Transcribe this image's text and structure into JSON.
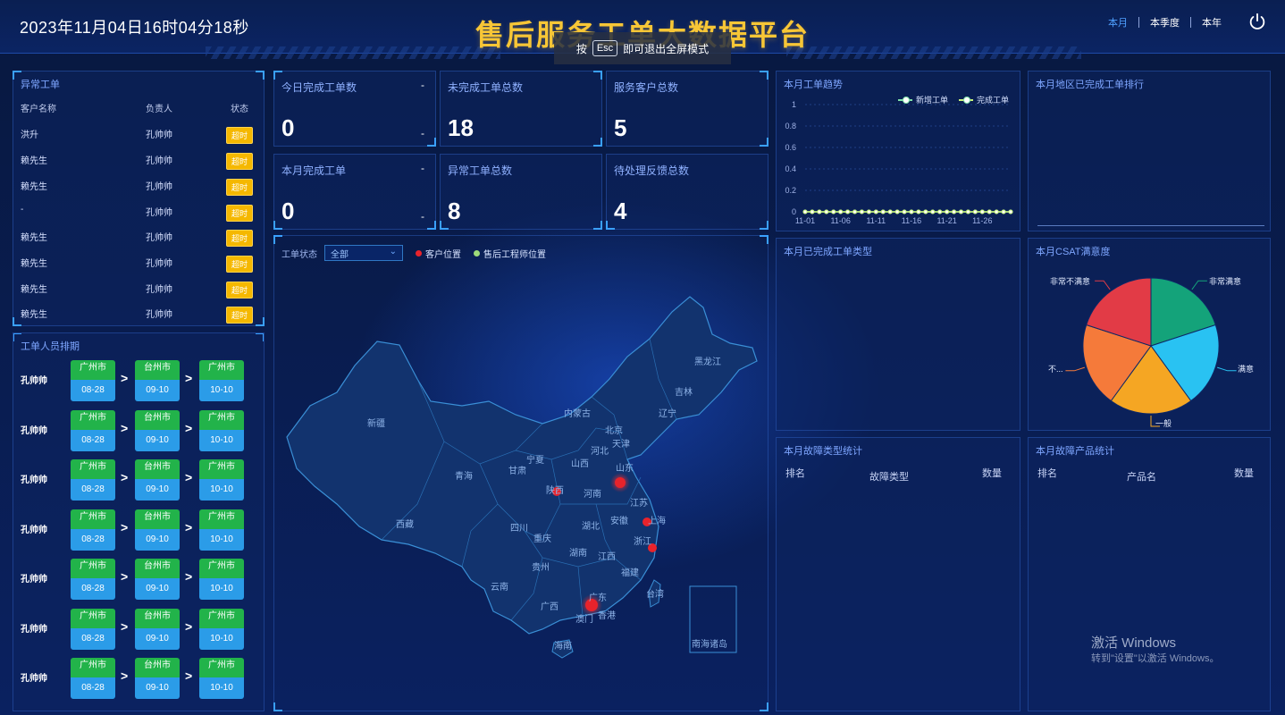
{
  "header": {
    "clock": "2023年11月04日16时04分18秒",
    "title": "售后服务工单大数据平台",
    "fullscreen_tip": {
      "prefix": "按",
      "key": "Esc",
      "suffix": "即可退出全屏模式"
    },
    "range_tabs": [
      "本月",
      "本季度",
      "本年"
    ],
    "active_range": "本月",
    "power_icon": "power-icon"
  },
  "abnormal": {
    "title": "异常工单",
    "columns": [
      "客户名称",
      "负责人",
      "状态"
    ],
    "rows": [
      {
        "customer": "洪升",
        "owner": "孔帅帅",
        "status": "超时"
      },
      {
        "customer": "赖先生",
        "owner": "孔帅帅",
        "status": "超时"
      },
      {
        "customer": "赖先生",
        "owner": "孔帅帅",
        "status": "超时"
      },
      {
        "customer": "-",
        "owner": "孔帅帅",
        "status": "超时"
      },
      {
        "customer": "赖先生",
        "owner": "孔帅帅",
        "status": "超时"
      },
      {
        "customer": "赖先生",
        "owner": "孔帅帅",
        "status": "超时"
      },
      {
        "customer": "赖先生",
        "owner": "孔帅帅",
        "status": "超时"
      },
      {
        "customer": "赖先生",
        "owner": "孔帅帅",
        "status": "超时"
      }
    ]
  },
  "schedule": {
    "title": "工单人员排期",
    "rows": [
      {
        "name": "孔帅帅",
        "stops": [
          {
            "city": "广州市",
            "date": "08-28"
          },
          {
            "city": "台州市",
            "date": "09-10"
          },
          {
            "city": "广州市",
            "date": "10-10"
          }
        ]
      },
      {
        "name": "孔帅帅",
        "stops": [
          {
            "city": "广州市",
            "date": "08-28"
          },
          {
            "city": "台州市",
            "date": "09-10"
          },
          {
            "city": "广州市",
            "date": "10-10"
          }
        ]
      },
      {
        "name": "孔帅帅",
        "stops": [
          {
            "city": "广州市",
            "date": "08-28"
          },
          {
            "city": "台州市",
            "date": "09-10"
          },
          {
            "city": "广州市",
            "date": "10-10"
          }
        ]
      },
      {
        "name": "孔帅帅",
        "stops": [
          {
            "city": "广州市",
            "date": "08-28"
          },
          {
            "city": "台州市",
            "date": "09-10"
          },
          {
            "city": "广州市",
            "date": "10-10"
          }
        ]
      },
      {
        "name": "孔帅帅",
        "stops": [
          {
            "city": "广州市",
            "date": "08-28"
          },
          {
            "city": "台州市",
            "date": "09-10"
          },
          {
            "city": "广州市",
            "date": "10-10"
          }
        ]
      },
      {
        "name": "孔帅帅",
        "stops": [
          {
            "city": "广州市",
            "date": "08-28"
          },
          {
            "city": "台州市",
            "date": "09-10"
          },
          {
            "city": "广州市",
            "date": "10-10"
          }
        ]
      },
      {
        "name": "孔帅帅",
        "stops": [
          {
            "city": "广州市",
            "date": "08-28"
          },
          {
            "city": "台州市",
            "date": "09-10"
          },
          {
            "city": "广州市",
            "date": "10-10"
          }
        ]
      }
    ],
    "arrow": ">"
  },
  "stats": [
    {
      "label": "今日完成工单数",
      "value": "0",
      "dash": "-"
    },
    {
      "label": "未完成工单总数",
      "value": "18"
    },
    {
      "label": "服务客户总数",
      "value": "5"
    },
    {
      "label": "本月完成工单",
      "value": "0",
      "dash": "-"
    },
    {
      "label": "异常工单总数",
      "value": "8"
    },
    {
      "label": "待处理反馈总数",
      "value": "4"
    }
  ],
  "map": {
    "filter_label": "工单状态",
    "filter_value": "全部",
    "legend": [
      {
        "label": "客户位置",
        "color": "#e8232b"
      },
      {
        "label": "售后工程师位置",
        "color": "#9ddb7a"
      }
    ],
    "provinces": [
      "黑龙江",
      "吉林",
      "辽宁",
      "内蒙古",
      "北京",
      "天津",
      "河北",
      "山东",
      "山西",
      "宁夏",
      "甘肃",
      "青海",
      "新疆",
      "西藏",
      "四川",
      "重庆",
      "陕西",
      "河南",
      "江苏",
      "安徽",
      "上海",
      "湖北",
      "浙江",
      "湖南",
      "江西",
      "贵州",
      "云南",
      "福建",
      "台湾",
      "广东",
      "广西",
      "香港",
      "澳门",
      "海南",
      "南海诸岛"
    ],
    "map_color": "#12336e",
    "border_color": "#3a8fd6"
  },
  "trend": {
    "title": "本月工单趋势",
    "chart_data": {
      "type": "line",
      "x": [
        "11-01",
        "11-02",
        "11-03",
        "11-04",
        "11-05",
        "11-06",
        "11-07",
        "11-08",
        "11-09",
        "11-10",
        "11-11",
        "11-12",
        "11-13",
        "11-14",
        "11-15",
        "11-16",
        "11-17",
        "11-18",
        "11-19",
        "11-20",
        "11-21",
        "11-22",
        "11-23",
        "11-24",
        "11-25",
        "11-26",
        "11-27",
        "11-28",
        "11-29",
        "11-30"
      ],
      "x_tick_labels": [
        "11-01",
        "11-06",
        "11-11",
        "11-16",
        "11-21",
        "11-26"
      ],
      "series": [
        {
          "name": "新增工单",
          "values": [
            0,
            0,
            0,
            0,
            0,
            0,
            0,
            0,
            0,
            0,
            0,
            0,
            0,
            0,
            0,
            0,
            0,
            0,
            0,
            0,
            0,
            0,
            0,
            0,
            0,
            0,
            0,
            0,
            0,
            0
          ],
          "color": "#7ee0a8"
        },
        {
          "name": "完成工单",
          "values": [
            0,
            0,
            0,
            0,
            0,
            0,
            0,
            0,
            0,
            0,
            0,
            0,
            0,
            0,
            0,
            0,
            0,
            0,
            0,
            0,
            0,
            0,
            0,
            0,
            0,
            0,
            0,
            0,
            0,
            0
          ],
          "color": "#c8f07a"
        }
      ],
      "ylim": [
        0,
        1
      ],
      "y_ticks": [
        "0",
        "0.2",
        "0.4",
        "0.6",
        "0.8",
        "1"
      ],
      "legend": "top-right"
    }
  },
  "region_rank": {
    "title": "本月地区已完成工单排行"
  },
  "completed_types": {
    "title": "本月已完成工单类型"
  },
  "csat": {
    "title": "本月CSAT满意度",
    "chart_data": {
      "type": "pie",
      "categories": [
        "非常满意",
        "满意",
        "一般",
        "不...",
        "非常不满意"
      ],
      "values": [
        20,
        20,
        20,
        20,
        20
      ],
      "colors": [
        "#14a37a",
        "#29c2f2",
        "#f5a623",
        "#f57a3a",
        "#e23b46"
      ]
    }
  },
  "fault_types": {
    "title": "本月故障类型统计",
    "columns": [
      "排名",
      "故障类型",
      "数量"
    ]
  },
  "fault_products": {
    "title": "本月故障产品统计",
    "columns": [
      "排名",
      "产品名",
      "数量"
    ]
  },
  "watermark": {
    "line1": "激活 Windows",
    "line2": "转到\"设置\"以激活 Windows。"
  }
}
